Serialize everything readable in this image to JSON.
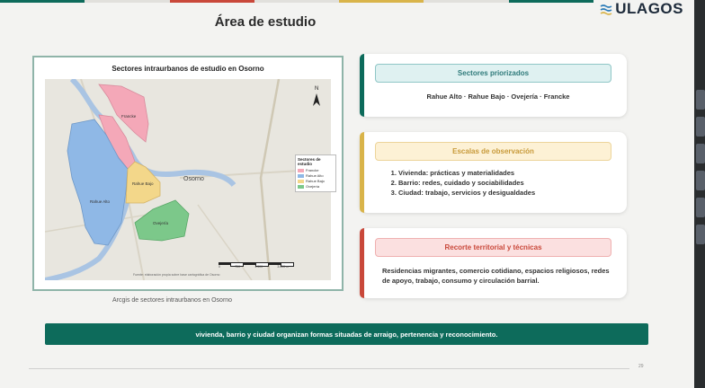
{
  "header": {
    "title": "Área de estudio",
    "brand": "ULAGOS",
    "bar_colors": [
      "#0d6b5b",
      "#e1e0dc",
      "#c9483a",
      "#e1e0dc",
      "#d9b44a",
      "#e1e0dc",
      "#0d6b5b"
    ]
  },
  "map": {
    "title": "Sectores intraurbanos de estudio en Osorno",
    "city_label": "Osorno",
    "north": "N",
    "sectors": [
      {
        "name": "Francke",
        "color": "#f4a8b8"
      },
      {
        "name": "Rahue Alto",
        "color": "#8fb8e6"
      },
      {
        "name": "Rahue Bajo",
        "color": "#f3d78a"
      },
      {
        "name": "Ovejería",
        "color": "#7cc88a"
      }
    ],
    "legend_title": "Sectores de estudio",
    "legend": [
      "Francke",
      "Rahue Alto",
      "Rahue Bajo",
      "Ovejería"
    ],
    "source": "Fuente: elaboración propia sobre base cartográfica de Osorno",
    "scale_labels": [
      "0",
      "750",
      "1.500",
      "3.000 m"
    ],
    "caption": "Arcgis de sectores intraurbanos  en Osorno"
  },
  "cards": [
    {
      "heading": "Sectores priorizados",
      "accent": "#0d6b5b",
      "pill_bg": "#dff1f1",
      "pill_border": "#8fc6c6",
      "pill_color": "#2f7a7a",
      "text": "Rahue Alto · Rahue Bajo · Ovejería · Francke"
    },
    {
      "heading": "Escalas de observación",
      "accent": "#d9b44a",
      "pill_bg": "#fdf1d5",
      "pill_border": "#ecd49a",
      "pill_color": "#c89a3a",
      "items": [
        "Vivienda: prácticas y materialidades",
        "Barrio: redes, cuidado y sociabilidades",
        "Ciudad: trabajo, servicios y desigualdades"
      ]
    },
    {
      "heading": "Recorte territorial y técnicas",
      "accent": "#c9483a",
      "pill_bg": "#fbe0e0",
      "pill_border": "#efb0b0",
      "pill_color": "#c9483a",
      "text": "Residencias migrantes, comercio cotidiano, espacios religiosos, redes de apoyo, trabajo, consumo y circulación barrial."
    }
  ],
  "banner": {
    "text": "vivienda, barrio y ciudad organizan formas situadas de arraigo, pertenencia y reconocimiento."
  },
  "footer": {
    "page": "29"
  }
}
